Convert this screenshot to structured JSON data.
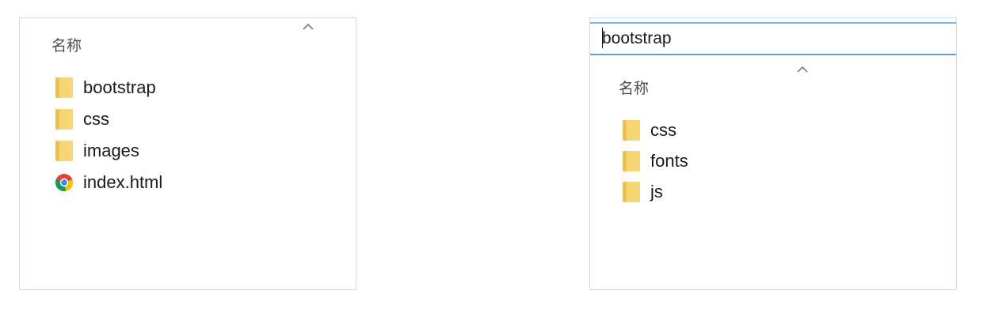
{
  "left_panel": {
    "column_header": "名称",
    "items": [
      {
        "name": "bootstrap",
        "icon": "folder-icon"
      },
      {
        "name": "css",
        "icon": "folder-icon"
      },
      {
        "name": "images",
        "icon": "folder-icon"
      },
      {
        "name": "index.html",
        "icon": "chrome-icon"
      }
    ]
  },
  "right_panel": {
    "address_value": "bootstrap",
    "column_header": "名称",
    "items": [
      {
        "name": "css",
        "icon": "folder-icon"
      },
      {
        "name": "fonts",
        "icon": "folder-icon"
      },
      {
        "name": "js",
        "icon": "folder-icon"
      }
    ]
  },
  "colors": {
    "folder_fill": "#f7d774",
    "folder_shade": "#e8c15a",
    "address_border": "#5a9fd6"
  }
}
